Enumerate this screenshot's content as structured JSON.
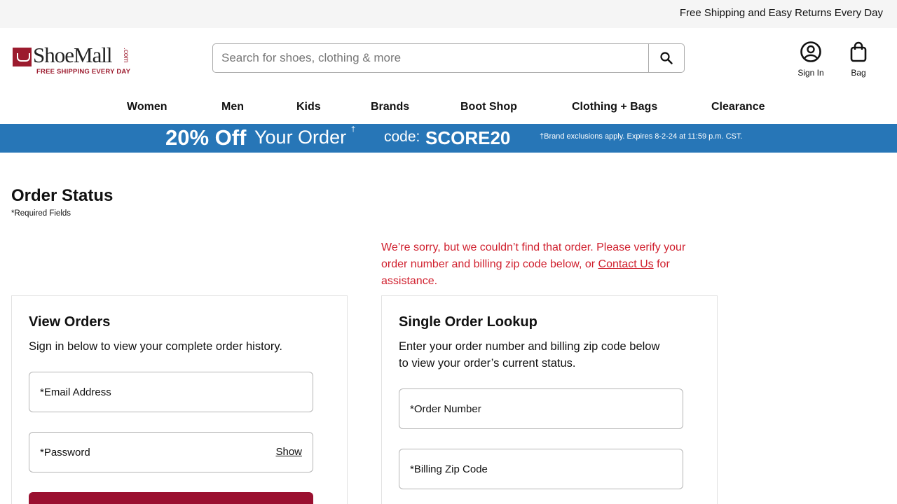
{
  "topbar": {
    "text": "Free Shipping and Easy Returns Every Day"
  },
  "logo": {
    "word": "ShoeMall",
    "suffix": ".com",
    "tagline": "FREE SHIPPING EVERY DAY"
  },
  "search": {
    "placeholder": "Search for shoes, clothing & more",
    "button_icon": "search-icon"
  },
  "header": {
    "sign_in_label": "Sign In",
    "bag_label": "Bag"
  },
  "nav": [
    "Women",
    "Men",
    "Kids",
    "Brands",
    "Boot Shop",
    "Clothing + Bags",
    "Clearance"
  ],
  "promo": {
    "headline_bold": "20% Off",
    "headline_rest": "Your Order",
    "dagger": "†",
    "code_label": "code:",
    "code": "SCORE20",
    "fine_print": "†Brand exclusions apply. Expires 8-2-24 at 11:59 p.m. CST."
  },
  "page": {
    "title": "Order Status",
    "required_note": "*Required Fields"
  },
  "error": {
    "before": "We’re sorry, but we couldn’t find that order. Please verify your order number and billing zip code below, or ",
    "link": "Contact Us",
    "after": " for assistance."
  },
  "view_orders": {
    "title": "View Orders",
    "description": "Sign in below to view your complete order history.",
    "email_placeholder": "*Email Address",
    "password_placeholder": "*Password",
    "show_label": "Show"
  },
  "single_lookup": {
    "title": "Single Order Lookup",
    "description": "Enter your order number and billing zip code below to view your order’s current status.",
    "order_placeholder": "*Order Number",
    "zip_placeholder": "*Billing Zip Code"
  },
  "colors": {
    "brand_red": "#9c1b2e",
    "promo_blue": "#2776b7",
    "error_red": "#d0202e",
    "button": "#9a1030"
  }
}
